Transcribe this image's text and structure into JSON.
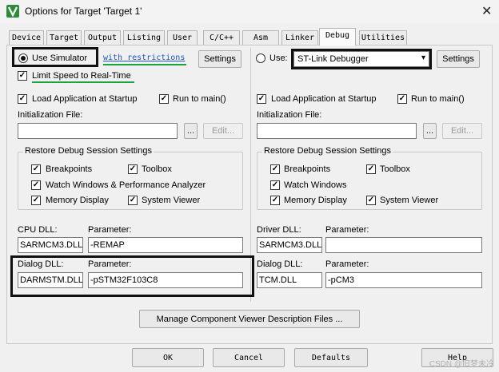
{
  "window": {
    "title": "Options for Target 'Target 1'",
    "close_glyph": "✕"
  },
  "tabs": [
    {
      "label": "Device"
    },
    {
      "label": "Target"
    },
    {
      "label": "Output"
    },
    {
      "label": "Listing"
    },
    {
      "label": "User"
    },
    {
      "label": "C/C++"
    },
    {
      "label": "Asm"
    },
    {
      "label": "Linker"
    },
    {
      "label": "Debug",
      "active": true
    },
    {
      "label": "Utilities"
    }
  ],
  "left": {
    "use_simulator": "Use Simulator",
    "restrictions_link": "with restrictions",
    "settings": "Settings",
    "limit_speed": "Limit Speed to Real-Time",
    "load_app": "Load Application at Startup",
    "run_main": "Run to main()",
    "init_file_label": "Initialization File:",
    "browse": "...",
    "edit": "Edit...",
    "restore_group": "Restore Debug Session Settings",
    "breakpoints": "Breakpoints",
    "toolbox": "Toolbox",
    "watch": "Watch Windows & Performance Analyzer",
    "memory": "Memory Display",
    "system_viewer": "System Viewer",
    "cpu_dll_label": "CPU DLL:",
    "parameter_label": "Parameter:",
    "cpu_dll": "SARMCM3.DLL",
    "cpu_param": "-REMAP",
    "dialog_dll_label": "Dialog DLL:",
    "dialog_dll": "DARMSTM.DLL",
    "dialog_param": "-pSTM32F103C8"
  },
  "right": {
    "use": "Use:",
    "debugger": "ST-Link Debugger",
    "settings": "Settings",
    "load_app": "Load Application at Startup",
    "run_main": "Run to main()",
    "init_file_label": "Initialization File:",
    "browse": "...",
    "edit": "Edit...",
    "restore_group": "Restore Debug Session Settings",
    "breakpoints": "Breakpoints",
    "toolbox": "Toolbox",
    "watch": "Watch Windows",
    "memory": "Memory Display",
    "system_viewer": "System Viewer",
    "driver_dll_label": "Driver DLL:",
    "parameter_label": "Parameter:",
    "driver_dll": "SARMCM3.DLL",
    "driver_param": "",
    "dialog_dll_label": "Dialog DLL:",
    "dialog_dll": "TCM.DLL",
    "dialog_param": "-pCM3"
  },
  "manage_button": "Manage Component Viewer Description Files ...",
  "footer": {
    "ok": "OK",
    "cancel": "Cancel",
    "defaults": "Defaults",
    "help": "Help"
  },
  "watermark": "CSDN @旧梦未冷",
  "colors": {
    "accent_green": "#1ea23b",
    "link_blue": "#1a56c8",
    "highlight_box": "#111111"
  },
  "check_glyph": "✓"
}
